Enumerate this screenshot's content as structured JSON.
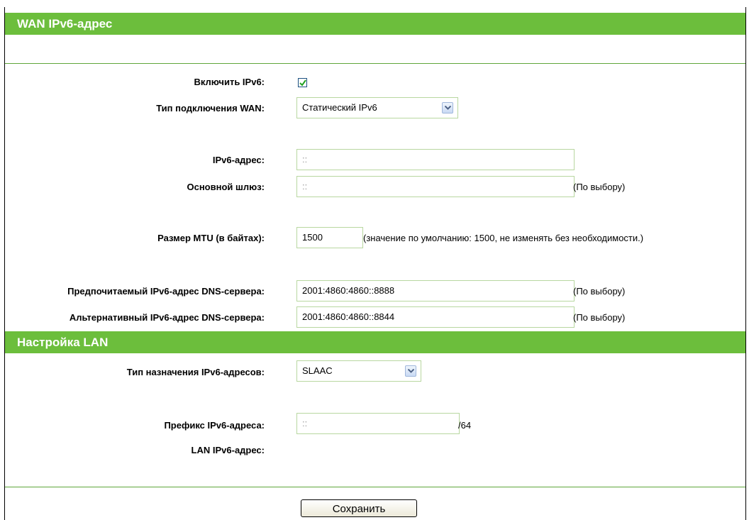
{
  "wan": {
    "header": "WAN IPv6-адрес",
    "enable_label": "Включить IPv6:",
    "enable_checked": true,
    "conn_type_label": "Тип подключения WAN:",
    "conn_type_value": "Статический IPv6",
    "ipv6_addr_label": "IPv6-адрес:",
    "ipv6_addr_value": "::",
    "gateway_label": "Основной шлюз:",
    "gateway_value": "::",
    "gateway_note": "(По выбору)",
    "mtu_label": "Размер MTU (в байтах):",
    "mtu_value": "1500",
    "mtu_note": "(значение по умолчанию: 1500, не изменять без необходимости.)",
    "dns1_label": "Предпочитаемый IPv6-адрес DNS-сервера:",
    "dns1_value": "2001:4860:4860::8888",
    "dns1_note": "(По выбору)",
    "dns2_label": "Альтернативный IPv6-адрес DNS-сервера:",
    "dns2_value": "2001:4860:4860::8844",
    "dns2_note": "(По выбору)"
  },
  "lan": {
    "header": "Настройка LAN",
    "assign_type_label": "Тип назначения IPv6-адресов:",
    "assign_type_value": "SLAAC",
    "prefix_label": "Префикс IPv6-адреса:",
    "prefix_value": "::",
    "prefix_suffix": "/64",
    "lan_addr_label": "LAN IPv6-адрес:"
  },
  "footer": {
    "save_label": "Сохранить"
  }
}
